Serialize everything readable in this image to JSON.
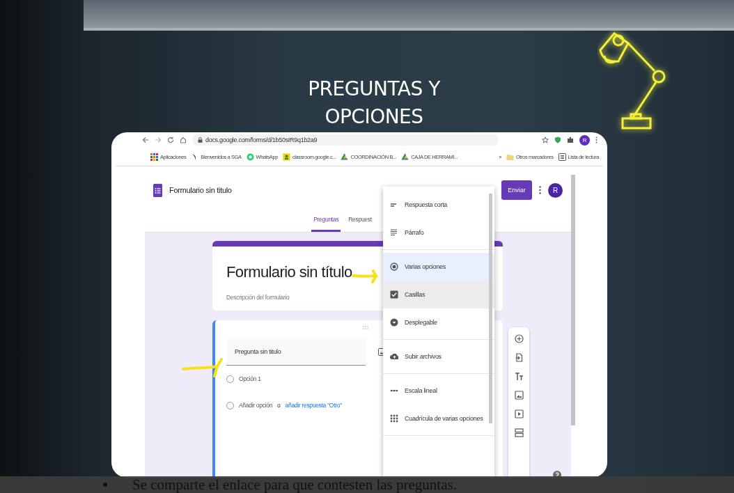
{
  "slide": {
    "title": "PREGUNTAS Y OPCIONES",
    "caption": "Se comparte el enlace para que contesten las preguntas."
  },
  "browser": {
    "url": "docs.google.com/forms/d/1b50sIR9q1b2a9",
    "profile": "R",
    "bookmarks": [
      {
        "label": "Aplicaciones",
        "kind": "apps"
      },
      {
        "label": "Bienvenidos a SGA",
        "kind": "sga"
      },
      {
        "label": "WhatsApp",
        "kind": "whatsapp"
      },
      {
        "label": "classroom.google.c...",
        "kind": "classroom"
      },
      {
        "label": "COORDINACIÓN B...",
        "kind": "drive"
      },
      {
        "label": "CAJA DE HERRAMI...",
        "kind": "drive"
      },
      {
        "label": "»",
        "kind": "more"
      },
      {
        "label": "Otros marcadores",
        "kind": "folder"
      },
      {
        "label": "Lista de lectura",
        "kind": "reading"
      }
    ]
  },
  "forms": {
    "doc_title": "Formulario sin titulo",
    "send": "Enviar",
    "avatar": "R",
    "tabs": [
      {
        "label": "Preguntas",
        "selected": true
      },
      {
        "label": "Respuest",
        "selected": false
      }
    ],
    "title": "Formulario sin título",
    "description": {
      "placeholder": "Descripción del formulario"
    },
    "question": {
      "placeholder": "Pregunta sin titulo",
      "options": [
        {
          "label": "Opción 1",
          "selected": false
        }
      ],
      "add_row": {
        "label": "Añadir opción",
        "selected": false,
        "or": "o",
        "link": "añadir respuesta \"Otro\""
      }
    }
  },
  "type_menu": {
    "groups": [
      {
        "items": [
          {
            "label": "Respuesta corta",
            "kind": "short",
            "selected": false,
            "hovered": false
          },
          {
            "label": "Párrafo",
            "kind": "paragraph",
            "selected": false,
            "hovered": false
          }
        ]
      },
      {
        "items": [
          {
            "label": "Varias opciones",
            "kind": "radio",
            "selected": true,
            "hovered": false
          },
          {
            "label": "Casillas",
            "kind": "checkbox",
            "selected": false,
            "hovered": true
          },
          {
            "label": "Desplegable",
            "kind": "dropdown",
            "selected": false,
            "hovered": false
          }
        ]
      },
      {
        "items": [
          {
            "label": "Subir archivos",
            "kind": "upload",
            "selected": false,
            "hovered": false
          }
        ]
      },
      {
        "items": [
          {
            "label": "Escala lineal",
            "kind": "scale",
            "selected": false,
            "hovered": false
          },
          {
            "label": "Cuadrícula de varias opciones",
            "kind": "grid",
            "selected": false,
            "hovered": false
          }
        ]
      }
    ]
  }
}
